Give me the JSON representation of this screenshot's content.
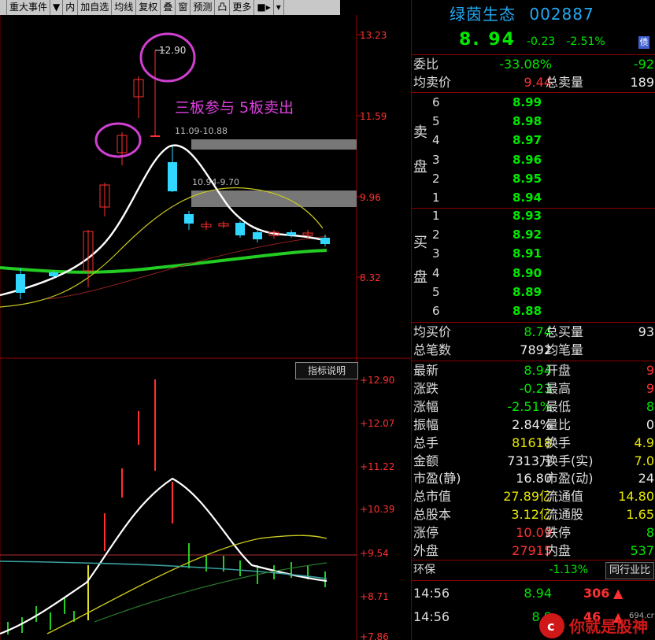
{
  "toolbar": {
    "items": [
      {
        "label": "重大事件",
        "has_dropdown": true
      },
      {
        "label": "内"
      },
      {
        "label": "加自选"
      },
      {
        "label": "均线"
      },
      {
        "label": "复权"
      },
      {
        "label": "叠"
      },
      {
        "label": "窗"
      },
      {
        "label": "预测"
      },
      {
        "label": "凸"
      },
      {
        "label": "更多"
      }
    ]
  },
  "main_chart": {
    "axis_labels": [
      "13.23",
      "11.59",
      "9.96",
      "8.32"
    ],
    "peak_label": "12.90",
    "annotation": "三板参与 5板卖出",
    "band1_label": "11.09-10.88",
    "band2_label": "10.94-9.70"
  },
  "indicator": {
    "button_label": "指标说明",
    "axis_labels": [
      "12.90",
      "12.07",
      "11.22",
      "10.39",
      "9.54",
      "8.71",
      "7.86"
    ]
  },
  "stock": {
    "name": "绿茵生态",
    "code": "002887",
    "price": "8. 94",
    "change": "-0.23",
    "pct": "-2.51%",
    "margin_badge": "债"
  },
  "quote_top": [
    {
      "label": "委比",
      "value": "-33.08%",
      "value_color": "grn",
      "label2": "",
      "value2": "-92",
      "value2_color": "grn"
    },
    {
      "label": "均卖价",
      "value": "9.44",
      "value_color": "red",
      "label2": "总卖量",
      "value2": "189",
      "value2_color": "wht"
    }
  ],
  "sell_side_label": [
    "卖",
    "盘"
  ],
  "sells": [
    {
      "n": "6",
      "price": "8.99"
    },
    {
      "n": "5",
      "price": "8.98"
    },
    {
      "n": "4",
      "price": "8.97"
    },
    {
      "n": "3",
      "price": "8.96"
    },
    {
      "n": "2",
      "price": "8.95"
    },
    {
      "n": "1",
      "price": "8.94"
    }
  ],
  "buy_side_label": [
    "买",
    "盘"
  ],
  "buys": [
    {
      "n": "1",
      "price": "8.93"
    },
    {
      "n": "2",
      "price": "8.92"
    },
    {
      "n": "3",
      "price": "8.91"
    },
    {
      "n": "4",
      "price": "8.90"
    },
    {
      "n": "5",
      "price": "8.89"
    },
    {
      "n": "6",
      "price": "8.88"
    }
  ],
  "quote_mid": [
    {
      "label": "均买价",
      "value": "8.74",
      "value_color": "grn",
      "label2": "总买量",
      "value2": "93",
      "value2_color": "wht"
    },
    {
      "label": "总笔数",
      "value": "7892",
      "value_color": "wht",
      "label2": "均笔量",
      "value2": "",
      "value2_color": "wht"
    }
  ],
  "stats": [
    {
      "label": "最新",
      "value": "8.94",
      "value_color": "grn",
      "label2": "开盘",
      "value2": "9",
      "value2_color": "red"
    },
    {
      "label": "涨跌",
      "value": "-0.23",
      "value_color": "grn",
      "label2": "最高",
      "value2": "9",
      "value2_color": "red"
    },
    {
      "label": "涨幅",
      "value": "-2.51%",
      "value_color": "grn",
      "label2": "最低",
      "value2": "8",
      "value2_color": "grn"
    },
    {
      "label": "振幅",
      "value": "2.84%",
      "value_color": "wht",
      "label2": "量比",
      "value2": "0",
      "value2_color": "wht"
    },
    {
      "label": "总手",
      "value": "81618",
      "value_color": "yel",
      "label2": "换手",
      "value2": "4.9",
      "value2_color": "yel"
    },
    {
      "label": "金额",
      "value": "7313万",
      "value_color": "wht",
      "label2": "换手(实)",
      "value2": "7.0",
      "value2_color": "yel"
    },
    {
      "label": "市盈(静)",
      "value": "16.80",
      "value_color": "wht",
      "label2": "市盈(动)",
      "value2": "24",
      "value2_color": "wht"
    },
    {
      "label": "总市值",
      "value": "27.89亿",
      "value_color": "yel",
      "label2": "流通值",
      "value2": "14.80",
      "value2_color": "yel"
    },
    {
      "label": "总股本",
      "value": "3.12亿",
      "value_color": "yel",
      "label2": "流通股",
      "value2": "1.65",
      "value2_color": "yel"
    },
    {
      "label": "涨停",
      "value": "10.09",
      "value_color": "red",
      "label2": "跌停",
      "value2": "8",
      "value2_color": "grn"
    },
    {
      "label": "外盘",
      "value": "27915",
      "value_color": "red",
      "label2": "内盘",
      "value2": "537",
      "value2_color": "grn"
    }
  ],
  "env": {
    "label": "环保",
    "value": "-1.13%",
    "button": "同行业比"
  },
  "ticks": [
    {
      "time": "14:56",
      "price": "8.94",
      "vol": "306"
    },
    {
      "time": "14:56",
      "price": "8.9",
      "vol": "46"
    }
  ],
  "watermark": {
    "text": "你就是股神",
    "site": "694.cn"
  },
  "colors": {
    "up": "#ff3030",
    "down": "#00e800",
    "accent": "#23a8f2",
    "annotation": "#e040e0"
  }
}
